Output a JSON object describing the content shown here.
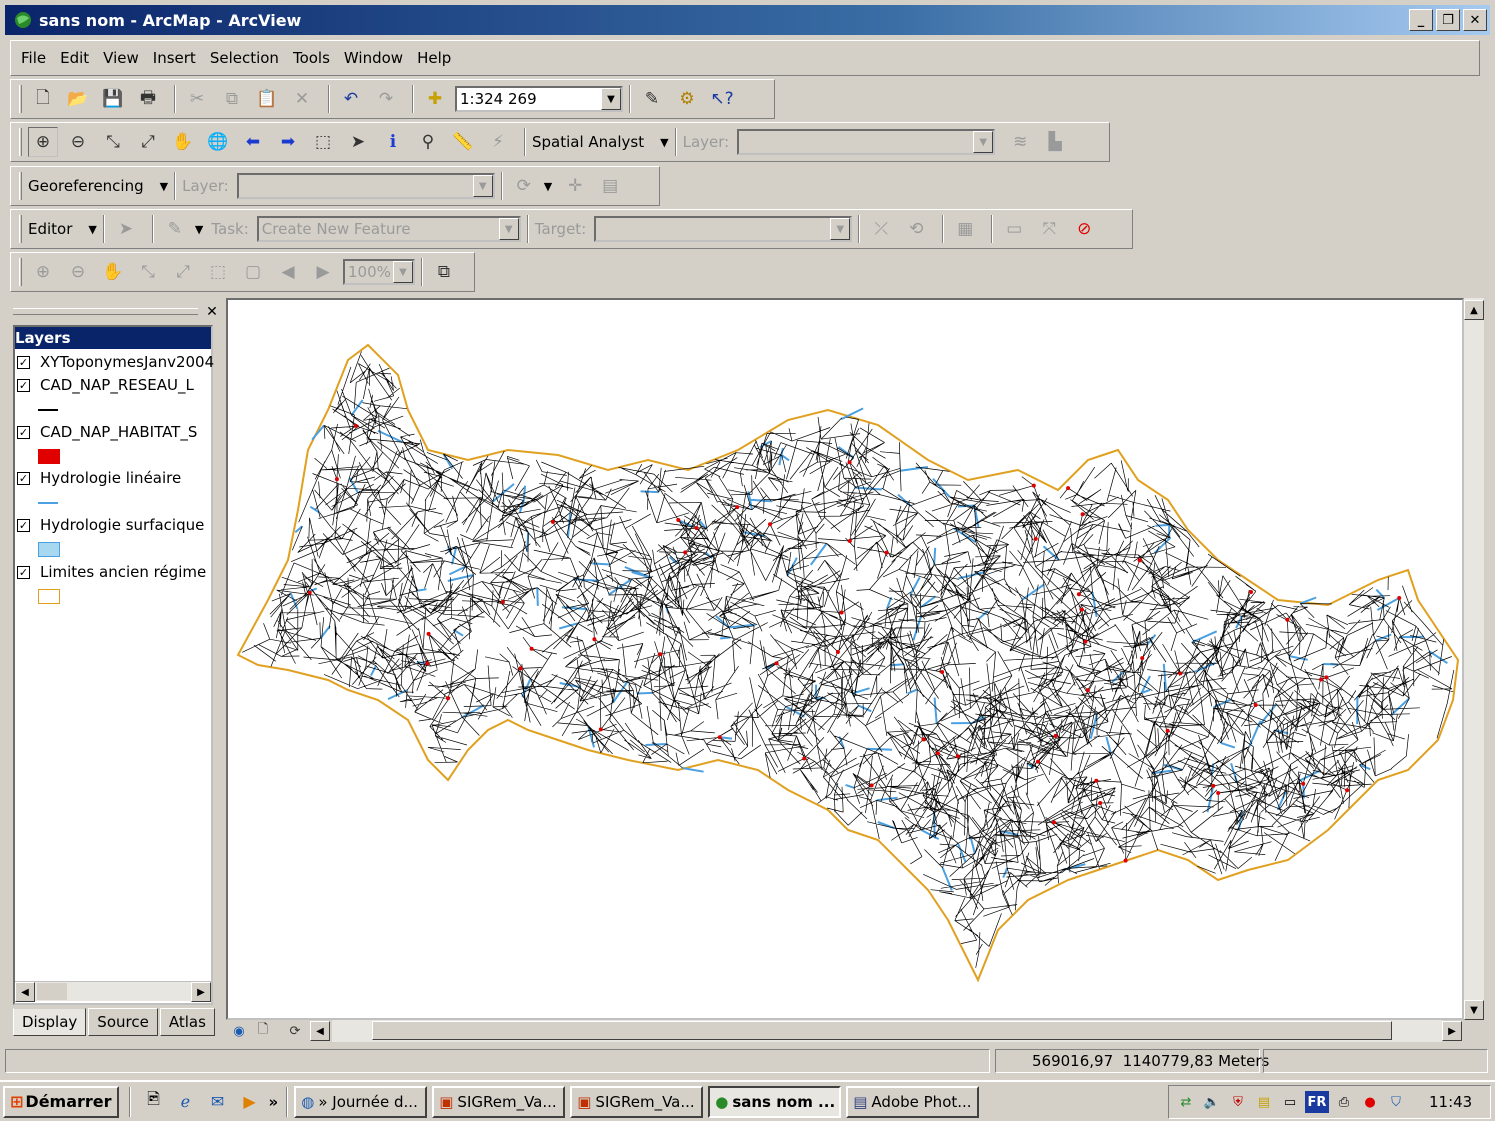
{
  "window": {
    "title": "sans nom - ArcMap - ArcView",
    "controls": [
      "_",
      "❐",
      "✕"
    ]
  },
  "menu": [
    "File",
    "Edit",
    "View",
    "Insert",
    "Selection",
    "Tools",
    "Window",
    "Help"
  ],
  "standard_toolbar": {
    "scale": "1:324 269"
  },
  "tools_toolbar": {
    "spatial_analyst_label": "Spatial Analyst",
    "layer_label": "Layer:"
  },
  "georef_toolbar": {
    "georeferencing_label": "Georeferencing",
    "layer_label": "Layer:"
  },
  "editor_toolbar": {
    "editor_label": "Editor",
    "task_label": "Task:",
    "task_value": "Create New Feature",
    "target_label": "Target:"
  },
  "layout_toolbar": {
    "zoom_percent": "100%"
  },
  "toc": {
    "header": "Layers",
    "layers": [
      {
        "name": "XYToponymesJanv2004",
        "checked": true,
        "symbol": "none"
      },
      {
        "name": "CAD_NAP_RESEAU_L",
        "checked": true,
        "symbol": "line",
        "color": "#000000"
      },
      {
        "name": "CAD_NAP_HABITAT_S",
        "checked": true,
        "symbol": "fill",
        "color": "#e00000"
      },
      {
        "name": "Hydrologie linéaire",
        "checked": true,
        "symbol": "line",
        "color": "#4aa0e0"
      },
      {
        "name": "Hydrologie surfacique",
        "checked": true,
        "symbol": "fill",
        "color": "#a8d8f0"
      },
      {
        "name": "Limites ancien régime",
        "checked": true,
        "symbol": "outline",
        "color": "#e0a020"
      }
    ],
    "tabs": [
      "Display",
      "Source",
      "Atlas"
    ]
  },
  "status": {
    "coordinates": "569016,97  1140779,83 Meters"
  },
  "taskbar": {
    "start_label": "Démarrer",
    "chevron": "»",
    "tasks": [
      "» Journée d...",
      "SIGRem_Va...",
      "SIGRem_Va...",
      "sans nom ...",
      "Adobe Phot..."
    ],
    "active_index": 3,
    "language": "FR",
    "clock": "11:43"
  },
  "colors": {
    "title_gradient_start": "#0a246a",
    "title_gradient_end": "#a6caf0",
    "chrome": "#d4d0c8",
    "network": "#000000",
    "water": "#4aa0e0",
    "boundary": "#e0a020",
    "habitat": "#e00000"
  }
}
